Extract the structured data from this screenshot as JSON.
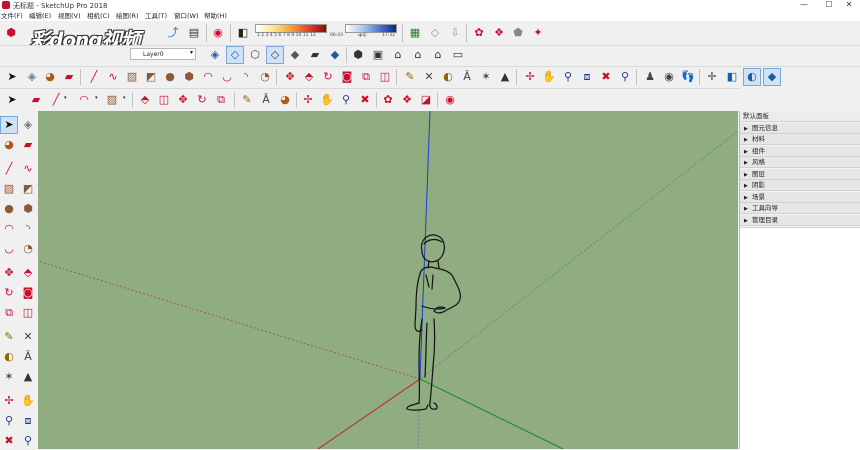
{
  "window": {
    "title": "无标题 - SketchUp Pro 2018",
    "minimize": "—",
    "maximize": "☐",
    "close": "✕"
  },
  "menu": [
    {
      "label": "文件(F)"
    },
    {
      "label": "编辑(E)"
    },
    {
      "label": "视图(V)"
    },
    {
      "label": "相机(C)"
    },
    {
      "label": "绘图(R)"
    },
    {
      "label": "工具(T)"
    },
    {
      "label": "窗口(W)"
    },
    {
      "label": "帮助(H)"
    }
  ],
  "watermark": "彩dong视频",
  "shadow_scale": {
    "months": "1 2 3 4 5 6 7 8 9 10 11 12",
    "time_start": "06:43",
    "time_mid": "中午",
    "time_end": "17:32"
  },
  "layer": {
    "current": "Layer0",
    "check": "✓"
  },
  "tray": {
    "title": "默认面板",
    "items": [
      {
        "label": "图元信息"
      },
      {
        "label": "材料"
      },
      {
        "label": "组件"
      },
      {
        "label": "风格"
      },
      {
        "label": "图层"
      },
      {
        "label": "阴影"
      },
      {
        "label": "场景"
      },
      {
        "label": "工具向导"
      },
      {
        "label": "管理目录"
      }
    ],
    "arrow": "▶"
  },
  "colors": {
    "viewport": "#8fad80",
    "axis_red": "#c21f1f",
    "axis_green": "#1a8a1a",
    "axis_blue": "#1a3fcf"
  }
}
